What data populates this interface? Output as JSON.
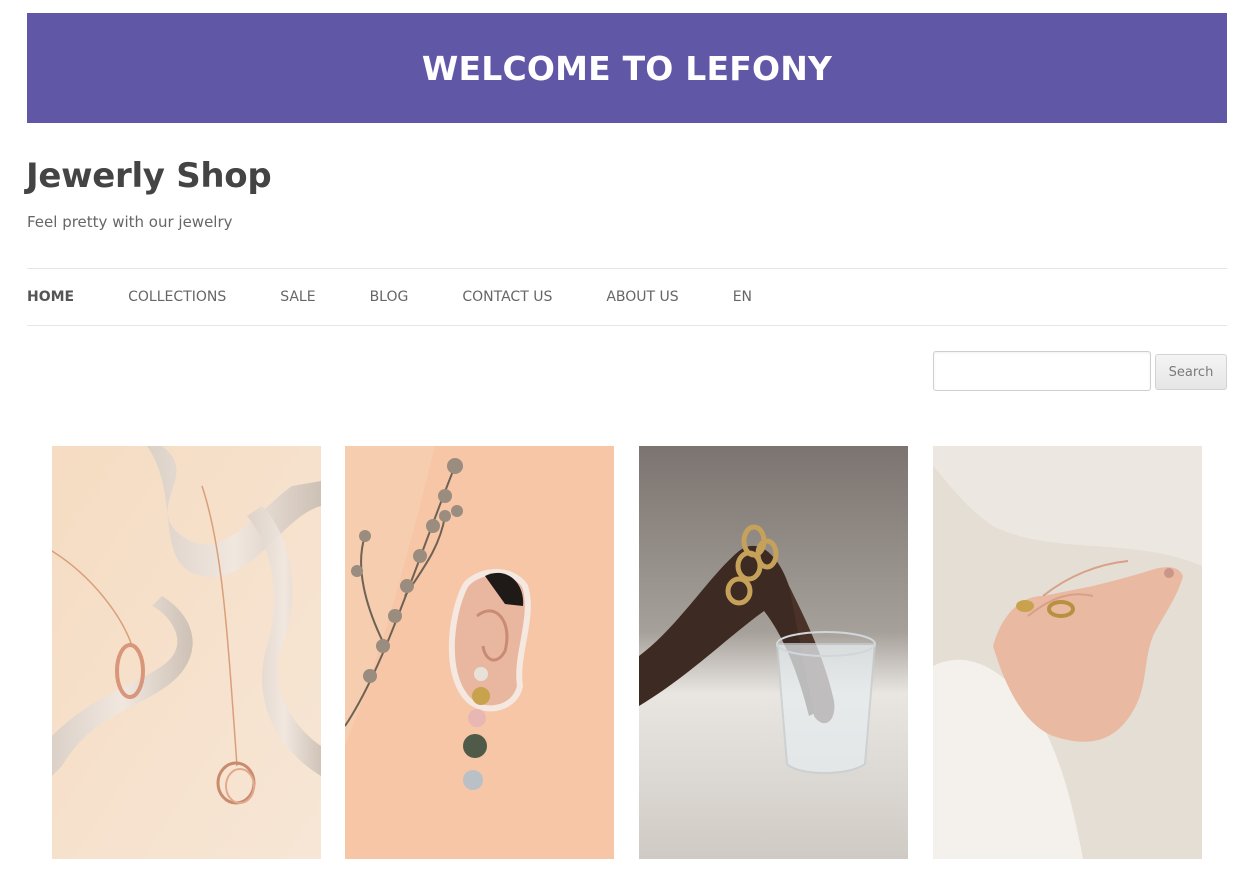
{
  "banner": {
    "title": "WELCOME TO LEFONY",
    "color": "#6157A7"
  },
  "site": {
    "title": "Jewerly Shop",
    "tagline": "Feel pretty with our jewelry"
  },
  "nav": {
    "items": [
      {
        "label": "HOME",
        "active": true
      },
      {
        "label": "COLLECTIONS",
        "active": false
      },
      {
        "label": "SALE",
        "active": false
      },
      {
        "label": "BLOG",
        "active": false
      },
      {
        "label": "CONTACT US",
        "active": false
      },
      {
        "label": "ABOUT US",
        "active": false
      },
      {
        "label": "EN",
        "active": false
      }
    ]
  },
  "search": {
    "value": "",
    "placeholder": "",
    "button_label": "Search"
  },
  "products": [
    {
      "icon": "necklace-photo"
    },
    {
      "icon": "earring-photo"
    },
    {
      "icon": "bracelet-photo"
    },
    {
      "icon": "rings-photo"
    }
  ]
}
